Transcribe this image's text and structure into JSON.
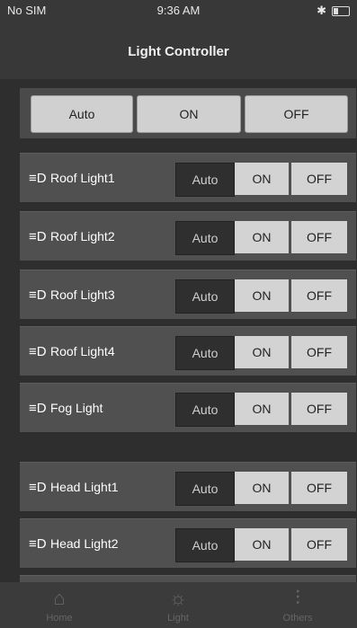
{
  "status": {
    "carrier": "No SIM",
    "time": "9:36 AM"
  },
  "nav": {
    "title": "Light Controller"
  },
  "master": {
    "auto": "Auto",
    "on": "ON",
    "off": "OFF"
  },
  "rows": [
    {
      "label": "Roof Light1",
      "auto": "Auto",
      "on": "ON",
      "off": "OFF",
      "icon": "roof-light-icon"
    },
    {
      "label": "Roof Light2",
      "auto": "Auto",
      "on": "ON",
      "off": "OFF",
      "icon": "roof-light-icon"
    },
    {
      "label": "Roof Light3",
      "auto": "Auto",
      "on": "ON",
      "off": "OFF",
      "icon": "roof-light-icon"
    },
    {
      "label": "Roof Light4",
      "auto": "Auto",
      "on": "ON",
      "off": "OFF",
      "icon": "roof-light-icon"
    },
    {
      "label": "Fog Light",
      "auto": "Auto",
      "on": "ON",
      "off": "OFF",
      "icon": "fog-light-icon"
    },
    {
      "label": "Head Light1",
      "auto": "Auto",
      "on": "ON",
      "off": "OFF",
      "icon": "head-light-icon"
    },
    {
      "label": "Head Light2",
      "auto": "Auto",
      "on": "ON",
      "off": "OFF",
      "icon": "head-light-icon"
    }
  ],
  "tabs": [
    {
      "label": "Home",
      "icon": "home-icon"
    },
    {
      "label": "Light",
      "icon": "sun-icon"
    },
    {
      "label": "Others",
      "icon": "sliders-icon"
    }
  ]
}
